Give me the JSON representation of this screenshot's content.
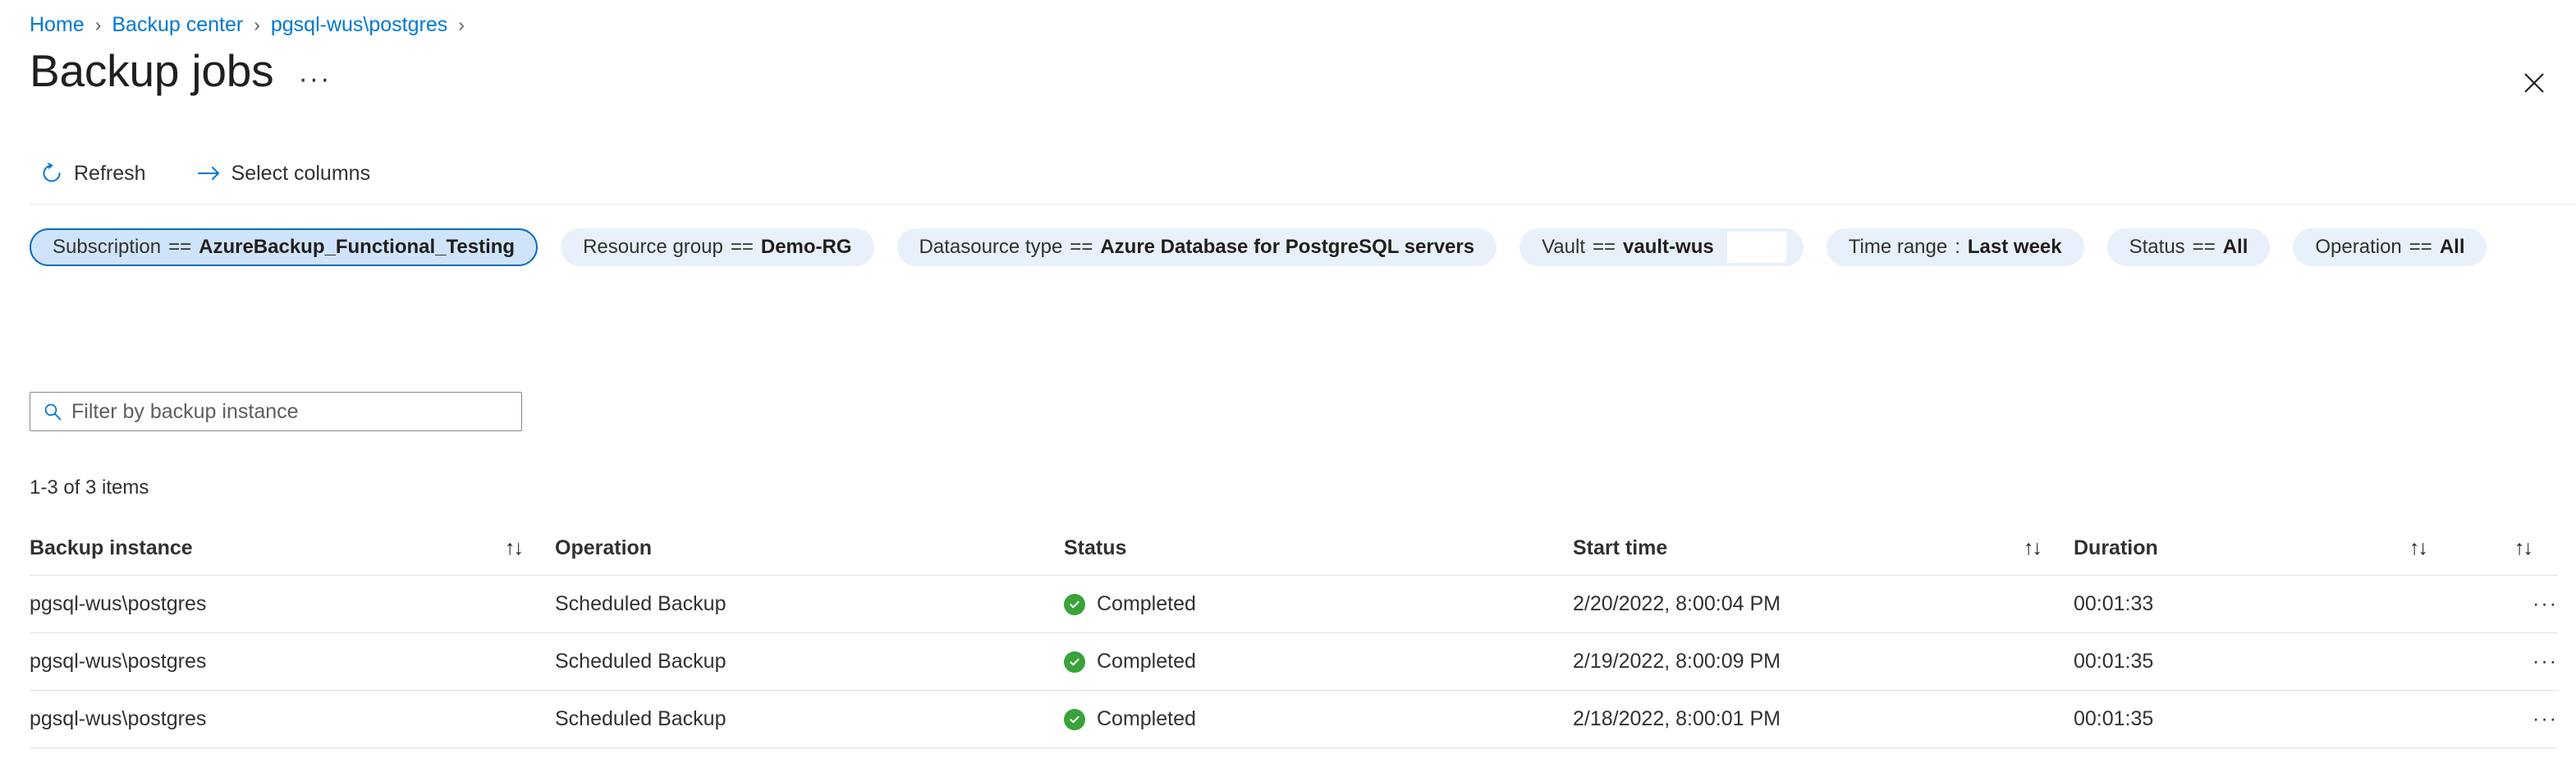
{
  "breadcrumb": {
    "items": [
      {
        "label": "Home"
      },
      {
        "label": "Backup center"
      },
      {
        "label": "pgsql-wus\\postgres"
      }
    ],
    "separator": "›"
  },
  "header": {
    "title": "Backup jobs",
    "ellipsis": "···",
    "close_icon": "close-icon"
  },
  "toolbar": {
    "refresh_label": "Refresh",
    "refresh_icon": "refresh-icon",
    "select_columns_label": "Select columns",
    "select_columns_icon": "arrow-right-icon"
  },
  "filters": [
    {
      "key": "Subscription",
      "operator": "==",
      "value": "AzureBackup_Functional_Testing",
      "active": true,
      "blank_field": false
    },
    {
      "key": "Resource group",
      "operator": "==",
      "value": "Demo-RG",
      "active": false,
      "blank_field": false
    },
    {
      "key": "Datasource type",
      "operator": "==",
      "value": "Azure Database for PostgreSQL servers",
      "active": false,
      "blank_field": false
    },
    {
      "key": "Vault",
      "operator": "==",
      "value": "vault-wus",
      "active": false,
      "blank_field": true
    },
    {
      "key": "Time range",
      "operator": ":",
      "value": "Last week",
      "active": false,
      "blank_field": false
    },
    {
      "key": "Status",
      "operator": "==",
      "value": "All",
      "active": false,
      "blank_field": false
    },
    {
      "key": "Operation",
      "operator": "==",
      "value": "All",
      "active": false,
      "blank_field": false
    }
  ],
  "search": {
    "placeholder": "Filter by backup instance",
    "value": "",
    "icon": "search-icon"
  },
  "results": {
    "count_text": "1-3 of 3 items"
  },
  "table": {
    "columns": [
      {
        "label": "Backup instance",
        "sortable": true,
        "sort_icon": "↑↓"
      },
      {
        "label": "Operation",
        "sortable": false,
        "sort_icon": ""
      },
      {
        "label": "Status",
        "sortable": false,
        "sort_icon": ""
      },
      {
        "label": "Start time",
        "sortable": true,
        "sort_icon": "↑↓"
      },
      {
        "label": "Duration",
        "sortable": true,
        "sort_icon": "↑↓"
      }
    ],
    "rows": [
      {
        "instance": "pgsql-wus\\postgres",
        "operation": "Scheduled Backup",
        "status": "Completed",
        "status_color": "#3aa23a",
        "start_time": "2/20/2022, 8:00:04 PM",
        "duration": "00:01:33",
        "menu": "···"
      },
      {
        "instance": "pgsql-wus\\postgres",
        "operation": "Scheduled Backup",
        "status": "Completed",
        "status_color": "#3aa23a",
        "start_time": "2/19/2022, 8:00:09 PM",
        "duration": "00:01:35",
        "menu": "···"
      },
      {
        "instance": "pgsql-wus\\postgres",
        "operation": "Scheduled Backup",
        "status": "Completed",
        "status_color": "#3aa23a",
        "start_time": "2/18/2022, 8:00:01 PM",
        "duration": "00:01:35",
        "menu": "···"
      }
    ]
  },
  "colors": {
    "link": "#0078d4",
    "pill_bg": "#e8f1fb",
    "pill_active_bg": "#cfe4fa",
    "pill_active_border": "#0f6cbd",
    "success": "#3aa23a",
    "divider": "#e1dfdd"
  }
}
